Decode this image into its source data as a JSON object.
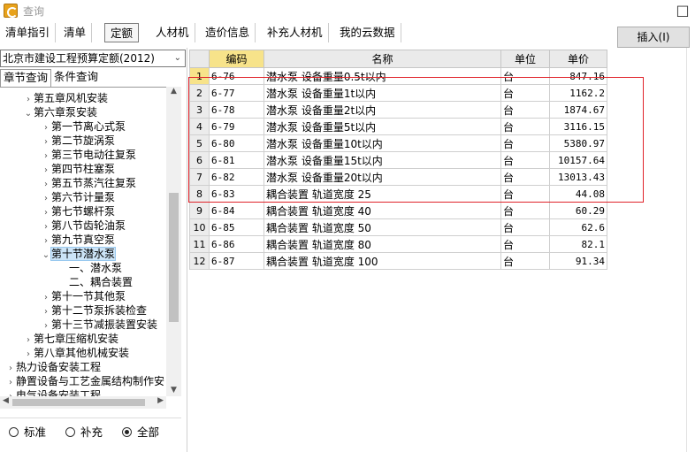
{
  "window": {
    "title": "查询"
  },
  "tabs": [
    "清单指引",
    "清单",
    "定额",
    "人材机",
    "造价信息",
    "补充人材机",
    "我的云数据"
  ],
  "active_tab": "定额",
  "insert_button": "插入(I)",
  "quota_library": "北京市建设工程预算定额(2012)",
  "subtabs": [
    "章节查询",
    "条件查询"
  ],
  "tree": [
    {
      "label": "第五章风机安装",
      "arrow": "›"
    },
    {
      "label": "第六章泵安装",
      "arrow": "⌄"
    },
    {
      "label": "第一节离心式泵",
      "arrow": "›"
    },
    {
      "label": "第二节旋涡泵",
      "arrow": "›"
    },
    {
      "label": "第三节电动往复泵",
      "arrow": "›"
    },
    {
      "label": "第四节柱塞泵",
      "arrow": "›"
    },
    {
      "label": "第五节蒸汽往复泵",
      "arrow": "›"
    },
    {
      "label": "第六节计量泵",
      "arrow": "›"
    },
    {
      "label": "第七节螺杆泵",
      "arrow": "›"
    },
    {
      "label": "第八节齿轮油泵",
      "arrow": "›"
    },
    {
      "label": "第九节真空泵",
      "arrow": "›"
    },
    {
      "label": "第十节潜水泵",
      "arrow": "⌄"
    },
    {
      "label": "一、潜水泵",
      "arrow": ""
    },
    {
      "label": "二、耦合装置",
      "arrow": ""
    },
    {
      "label": "第十一节其他泵",
      "arrow": "›"
    },
    {
      "label": "第十二节泵拆装检查",
      "arrow": "›"
    },
    {
      "label": "第十三节减振装置安装",
      "arrow": "›"
    },
    {
      "label": "第七章压缩机安装",
      "arrow": "›"
    },
    {
      "label": "第八章其他机械安装",
      "arrow": "›"
    },
    {
      "label": "热力设备安装工程",
      "arrow": "›"
    },
    {
      "label": "静置设备与工艺金属结构制作安",
      "arrow": "›"
    },
    {
      "label": "电气设备安装工程",
      "arrow": "›"
    }
  ],
  "radio_options": [
    "标准",
    "补充",
    "全部"
  ],
  "radio_selected": "全部",
  "table": {
    "headers": [
      "编码",
      "名称",
      "单位",
      "单价"
    ],
    "rows": [
      {
        "no": "1",
        "code": "6-76",
        "name": "潜水泵 设备重量0.5t以内",
        "unit": "台",
        "price": "847.16"
      },
      {
        "no": "2",
        "code": "6-77",
        "name": "潜水泵 设备重量1t以内",
        "unit": "台",
        "price": "1162.2"
      },
      {
        "no": "3",
        "code": "6-78",
        "name": "潜水泵 设备重量2t以内",
        "unit": "台",
        "price": "1874.67"
      },
      {
        "no": "4",
        "code": "6-79",
        "name": "潜水泵 设备重量5t以内",
        "unit": "台",
        "price": "3116.15"
      },
      {
        "no": "5",
        "code": "6-80",
        "name": "潜水泵 设备重量10t以内",
        "unit": "台",
        "price": "5380.97"
      },
      {
        "no": "6",
        "code": "6-81",
        "name": "潜水泵 设备重量15t以内",
        "unit": "台",
        "price": "10157.64"
      },
      {
        "no": "7",
        "code": "6-82",
        "name": "潜水泵 设备重量20t以内",
        "unit": "台",
        "price": "13013.43"
      },
      {
        "no": "8",
        "code": "6-83",
        "name": "耦合装置 轨道宽度 25",
        "unit": "台",
        "price": "44.08"
      },
      {
        "no": "9",
        "code": "6-84",
        "name": "耦合装置 轨道宽度 40",
        "unit": "台",
        "price": "60.29"
      },
      {
        "no": "10",
        "code": "6-85",
        "name": "耦合装置 轨道宽度 50",
        "unit": "台",
        "price": "62.6"
      },
      {
        "no": "11",
        "code": "6-86",
        "name": "耦合装置 轨道宽度 80",
        "unit": "台",
        "price": "82.1"
      },
      {
        "no": "12",
        "code": "6-87",
        "name": "耦合装置 轨道宽度 100",
        "unit": "台",
        "price": "91.34"
      }
    ]
  },
  "colors": {
    "highlight_header": "#f7e38a",
    "red_box": "#e0232a",
    "selection": "#cce4f7"
  }
}
